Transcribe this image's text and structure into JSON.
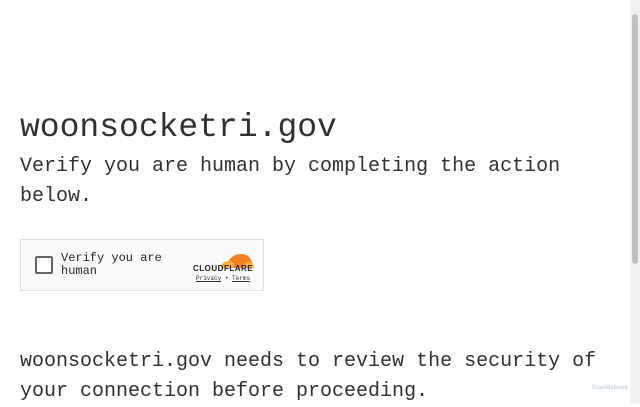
{
  "page": {
    "site": "woonsocketri.gov",
    "instruction": "Verify you are human by completing the action below.",
    "security_notice": "woonsocketri.gov needs to review the security of your connection before proceeding."
  },
  "widget": {
    "checkbox_label": "Verify you are human",
    "brand": "CLOUDFLARE",
    "privacy_link": "Privacy",
    "separator": "•",
    "terms_link": "Terms",
    "brand_colors": {
      "orange": "#f38020",
      "light_orange": "#faae40"
    }
  },
  "badge": {
    "text": "ScanMalware"
  }
}
